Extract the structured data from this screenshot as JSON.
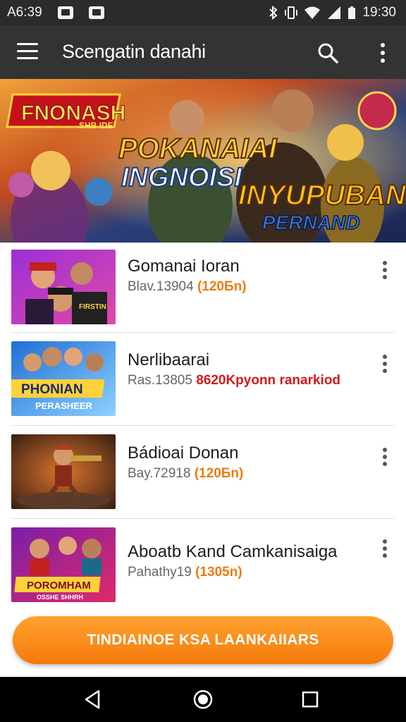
{
  "status_bar": {
    "time_left": "A6:39",
    "time_right": "19:30",
    "icons": [
      "notification-icon",
      "notification-icon",
      "bluetooth-icon",
      "vibrate-icon",
      "wifi-icon",
      "signal-icon",
      "battery-icon"
    ]
  },
  "app_bar": {
    "title": "Scengatin danahi",
    "icons": [
      "menu-icon",
      "search-icon",
      "more-vert-icon"
    ]
  },
  "banner": {
    "logo_text": "FNONASH",
    "logo_sub": "SHB IDE",
    "headline_1": "POKANAIAI",
    "headline_2": "INGNOISI",
    "headline_3": "INYUPUBAN",
    "headline_4": "PERNAND"
  },
  "list": {
    "items": [
      {
        "title": "Gomanai Ioran",
        "meta_prefix": "Blav.13904",
        "meta_price": "(120Бn)",
        "thumb_text": "FIRSTIN",
        "colors": [
          "#9b2fd6",
          "#e04aa8"
        ]
      },
      {
        "title": "Nerlibaarai",
        "meta_prefix": "Ras.13805",
        "meta_price": "8620Kpyonn ranarkiod",
        "thumb_text": "PHONIAN",
        "thumb_sub": "PERASHEER",
        "colors": [
          "#1f6fd6",
          "#ffd23a"
        ]
      },
      {
        "title": "Bádioai Donan",
        "meta_prefix": "Bay.72918",
        "meta_price": "(120Бn)",
        "colors": [
          "#6b3a2a",
          "#d9752b"
        ]
      },
      {
        "title": "Aboatb Kand Camkanisaiga",
        "meta_prefix": "Pahathy19",
        "meta_price": "(1305n)",
        "thumb_text": "POROMHAM",
        "thumb_sub": "OSSHE SHHRH",
        "colors": [
          "#7a1ea8",
          "#e02a6a"
        ]
      }
    ]
  },
  "cta": {
    "label": "TINDIAINOE KSA LAANKAIIARS"
  },
  "nav_bar": {
    "icons": [
      "back-icon",
      "home-icon",
      "recents-icon"
    ]
  }
}
